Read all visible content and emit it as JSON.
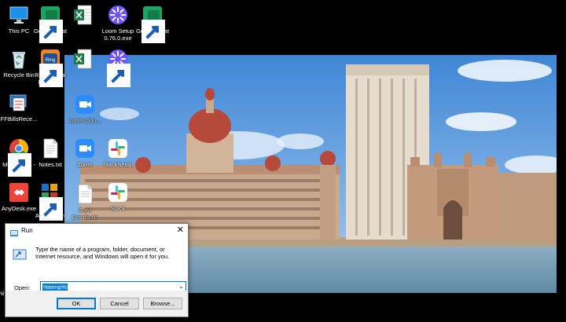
{
  "desktop": {
    "icons": [
      {
        "id": "this-pc",
        "label": "This PC",
        "icon": "monitor-icon"
      },
      {
        "id": "google-chat",
        "label": "Google Chat",
        "icon": "google-chat-icon"
      },
      {
        "id": "excel-1",
        "label": "",
        "icon": "excel-icon"
      },
      {
        "id": "loom-setup",
        "label": "Loom Setup 0.76.0.exe",
        "icon": "loom-icon"
      },
      {
        "id": "google-chat-2",
        "label": "Google Chat (2)",
        "icon": "google-chat-icon"
      },
      {
        "id": "recycle-bin",
        "label": "Recycle Bin",
        "icon": "recycle-bin-icon"
      },
      {
        "id": "ringcentral",
        "label": "RingCentral Meetings",
        "icon": "ringcentral-icon"
      },
      {
        "id": "excel-2",
        "label": "",
        "icon": "excel-icon"
      },
      {
        "id": "loom",
        "label": "Loom",
        "icon": "loom-icon"
      },
      {
        "id": "ffbills",
        "label": "FFBillsRece...",
        "icon": "ffbills-icon"
      },
      {
        "id": "zoom-1",
        "label": "zoom-clou...",
        "icon": "zoom-icon"
      },
      {
        "id": "meymoona",
        "label": "Meymoona - Chrome",
        "icon": "chrome-icon"
      },
      {
        "id": "notes",
        "label": "Notes.txt",
        "icon": "text-file-icon"
      },
      {
        "id": "zoom-2",
        "label": "Zoom",
        "icon": "zoom-icon"
      },
      {
        "id": "slack-setup",
        "label": "SlackSetup",
        "icon": "slack-icon"
      },
      {
        "id": "anydesk",
        "label": "AnyDesk.exe",
        "icon": "anydesk-icon"
      },
      {
        "id": "ff-bills-automation",
        "label": "FF Bills Automation",
        "icon": "ff-bills-automation-icon"
      },
      {
        "id": "card-details",
        "label": "Card Details.txt",
        "icon": "text-file-icon"
      },
      {
        "id": "slack",
        "label": "Slack",
        "icon": "slack-icon"
      },
      {
        "id": "partial",
        "label": "Ni",
        "icon": "partial-icon"
      }
    ]
  },
  "run_dialog": {
    "title": "Run",
    "close_glyph": "✕",
    "description": "Type the name of a program, folder, document, or Internet resource, and Windows will open it for you.",
    "open_label": "Open:",
    "open_value": "%temp%",
    "ok_label": "OK",
    "cancel_label": "Cancel",
    "browse_label": "Browse...",
    "accent_color": "#0078d7"
  }
}
